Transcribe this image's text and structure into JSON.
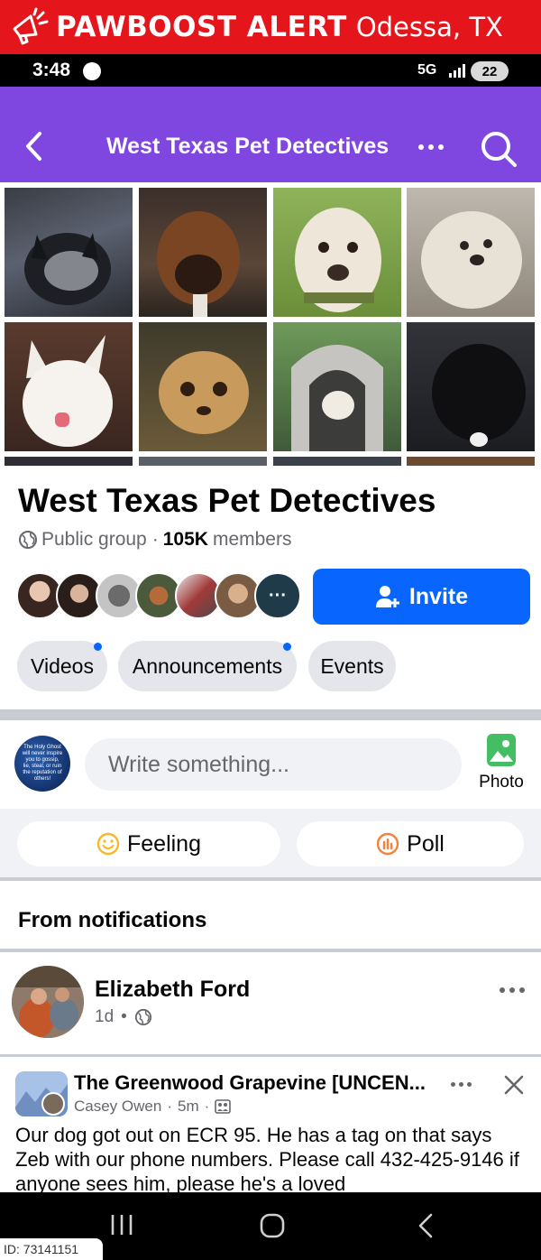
{
  "alert": {
    "brand": "PAWBOOST ALERT",
    "city": "Odessa, TX",
    "icon": "megaphone-icon",
    "color": "#e4161b"
  },
  "status_bar": {
    "time": "3:48",
    "network": "5G",
    "battery": "22"
  },
  "header": {
    "title": "West Texas Pet Detectives",
    "accent": "#7f46e0"
  },
  "group": {
    "name": "West Texas Pet Detectives",
    "privacy": "Public group",
    "separator": "·",
    "member_count": "105K",
    "member_label": "members",
    "invite_label": "Invite",
    "more_members": "···"
  },
  "tabs": [
    {
      "label": "Videos",
      "has_dot": true
    },
    {
      "label": "Announcements",
      "has_dot": true
    },
    {
      "label": "Events",
      "has_dot": false
    }
  ],
  "composer": {
    "placeholder": "Write something...",
    "photo_label": "Photo",
    "avatar_text": "The Holy Ghost will never inspire you to gossip, lie, steal, or ruin the reputation of others!",
    "feeling_label": "Feeling",
    "poll_label": "Poll"
  },
  "feed": {
    "section_title": "From notifications",
    "post": {
      "author": "Elizabeth Ford",
      "time": "1d",
      "dot": "•"
    },
    "shared": {
      "group": "The Greenwood Grapevine [UNCEN...",
      "author": "Casey Owen",
      "time": "5m",
      "text": "Our dog got out on ECR 95. He has a tag on that says Zeb with our phone numbers. Please call 432-425-9146 if anyone sees him, please he's a loved"
    }
  },
  "footer": {
    "id_label": "ID: 73141151"
  }
}
